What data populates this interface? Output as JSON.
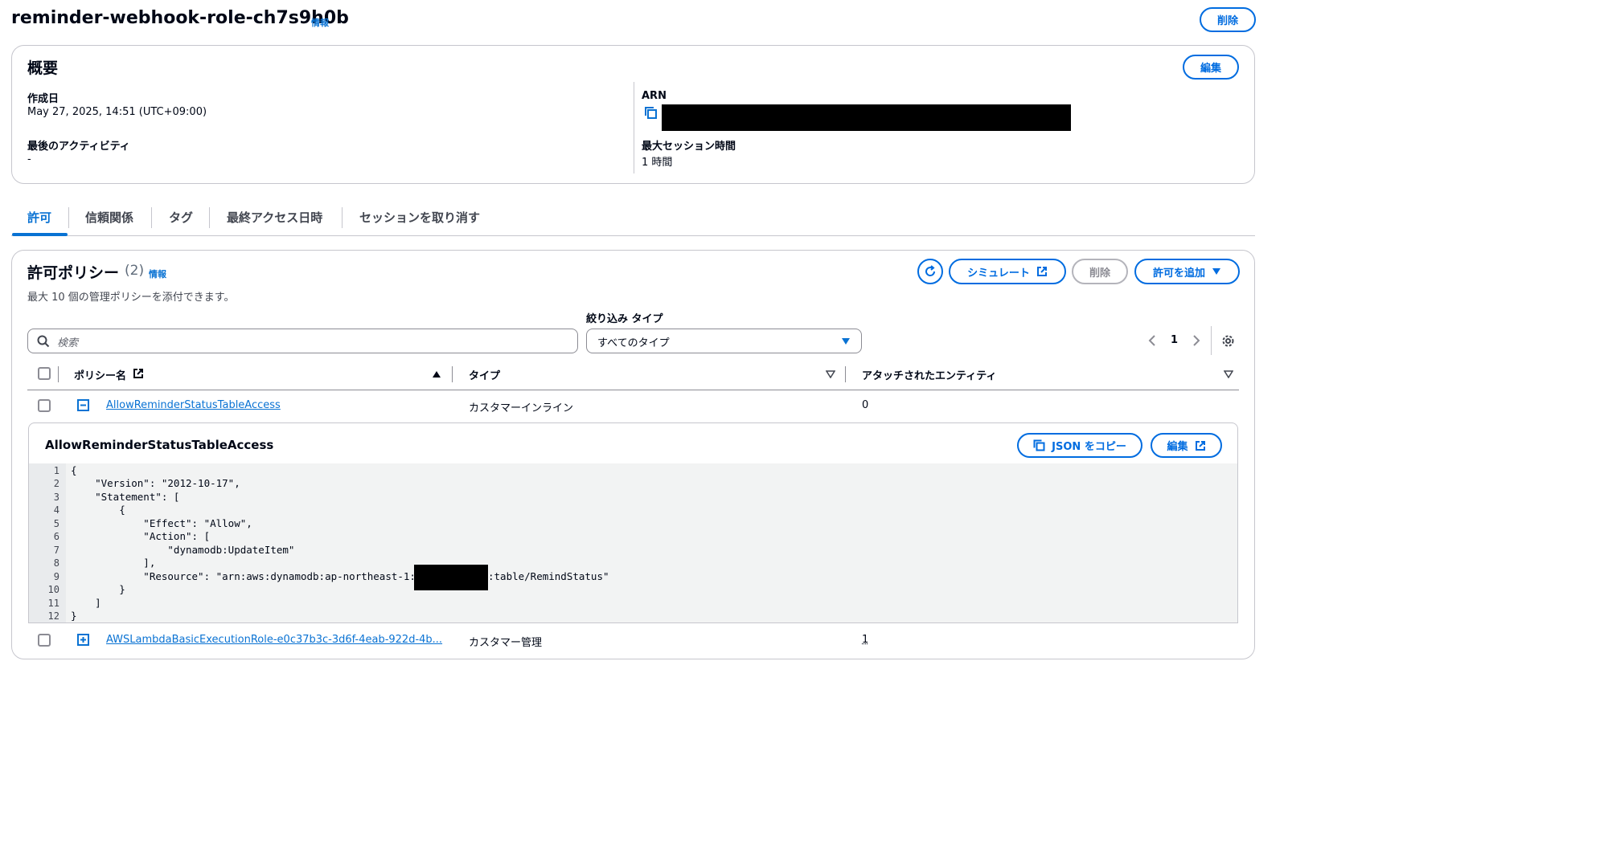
{
  "header": {
    "title": "reminder-webhook-role-ch7s9h0b",
    "info": "情報",
    "delete_label": "削除"
  },
  "summary": {
    "title": "概要",
    "edit_label": "編集",
    "created_label": "作成日",
    "created_value": "May 27, 2025, 14:51 (UTC+09:00)",
    "last_activity_label": "最後のアクティビティ",
    "last_activity_value": "-",
    "arn_label": "ARN",
    "max_session_label": "最大セッション時間",
    "max_session_value": "1 時間"
  },
  "tabs": [
    {
      "label": "許可"
    },
    {
      "label": "信頼関係"
    },
    {
      "label": "タグ"
    },
    {
      "label": "最終アクセス日時"
    },
    {
      "label": "セッションを取り消す"
    }
  ],
  "policies": {
    "title": "許可ポリシー",
    "count": "(2)",
    "info": "情報",
    "description": "最大 10 個の管理ポリシーを添付できます。",
    "simulate_label": "シミュレート",
    "delete_label": "削除",
    "add_label": "許可を追加",
    "search_placeholder": "検索",
    "filter_label": "絞り込み タイプ",
    "filter_value": "すべてのタイプ",
    "page_number": "1",
    "columns": {
      "name": "ポリシー名",
      "type": "タイプ",
      "entities": "アタッチされたエンティティ"
    },
    "rows": [
      {
        "name": "AllowReminderStatusTableAccess",
        "type": "カスタマーインライン",
        "entities": "0"
      },
      {
        "name": "AWSLambdaBasicExecutionRole-e0c37b3c-3d6f-4eab-922d-4b...",
        "type": "カスタマー管理",
        "entities": "1"
      }
    ],
    "detail": {
      "title": "AllowReminderStatusTableAccess",
      "copy_json_label": "JSON をコピー",
      "edit_label": "編集",
      "code_lines": [
        "{",
        "    \"Version\": \"2012-10-17\",",
        "    \"Statement\": [",
        "        {",
        "            \"Effect\": \"Allow\",",
        "            \"Action\": [",
        "                \"dynamodb:UpdateItem\"",
        "            ],",
        "            \"Resource\": \"arn:aws:dynamodb:ap-northeast-1:",
        "        }",
        "    ]",
        "}"
      ],
      "resource_suffix": ":table/RemindStatus\"",
      "line_numbers": [
        "1",
        "2",
        "3",
        "4",
        "5",
        "6",
        "7",
        "8",
        "9",
        "10",
        "11",
        "12"
      ]
    }
  }
}
